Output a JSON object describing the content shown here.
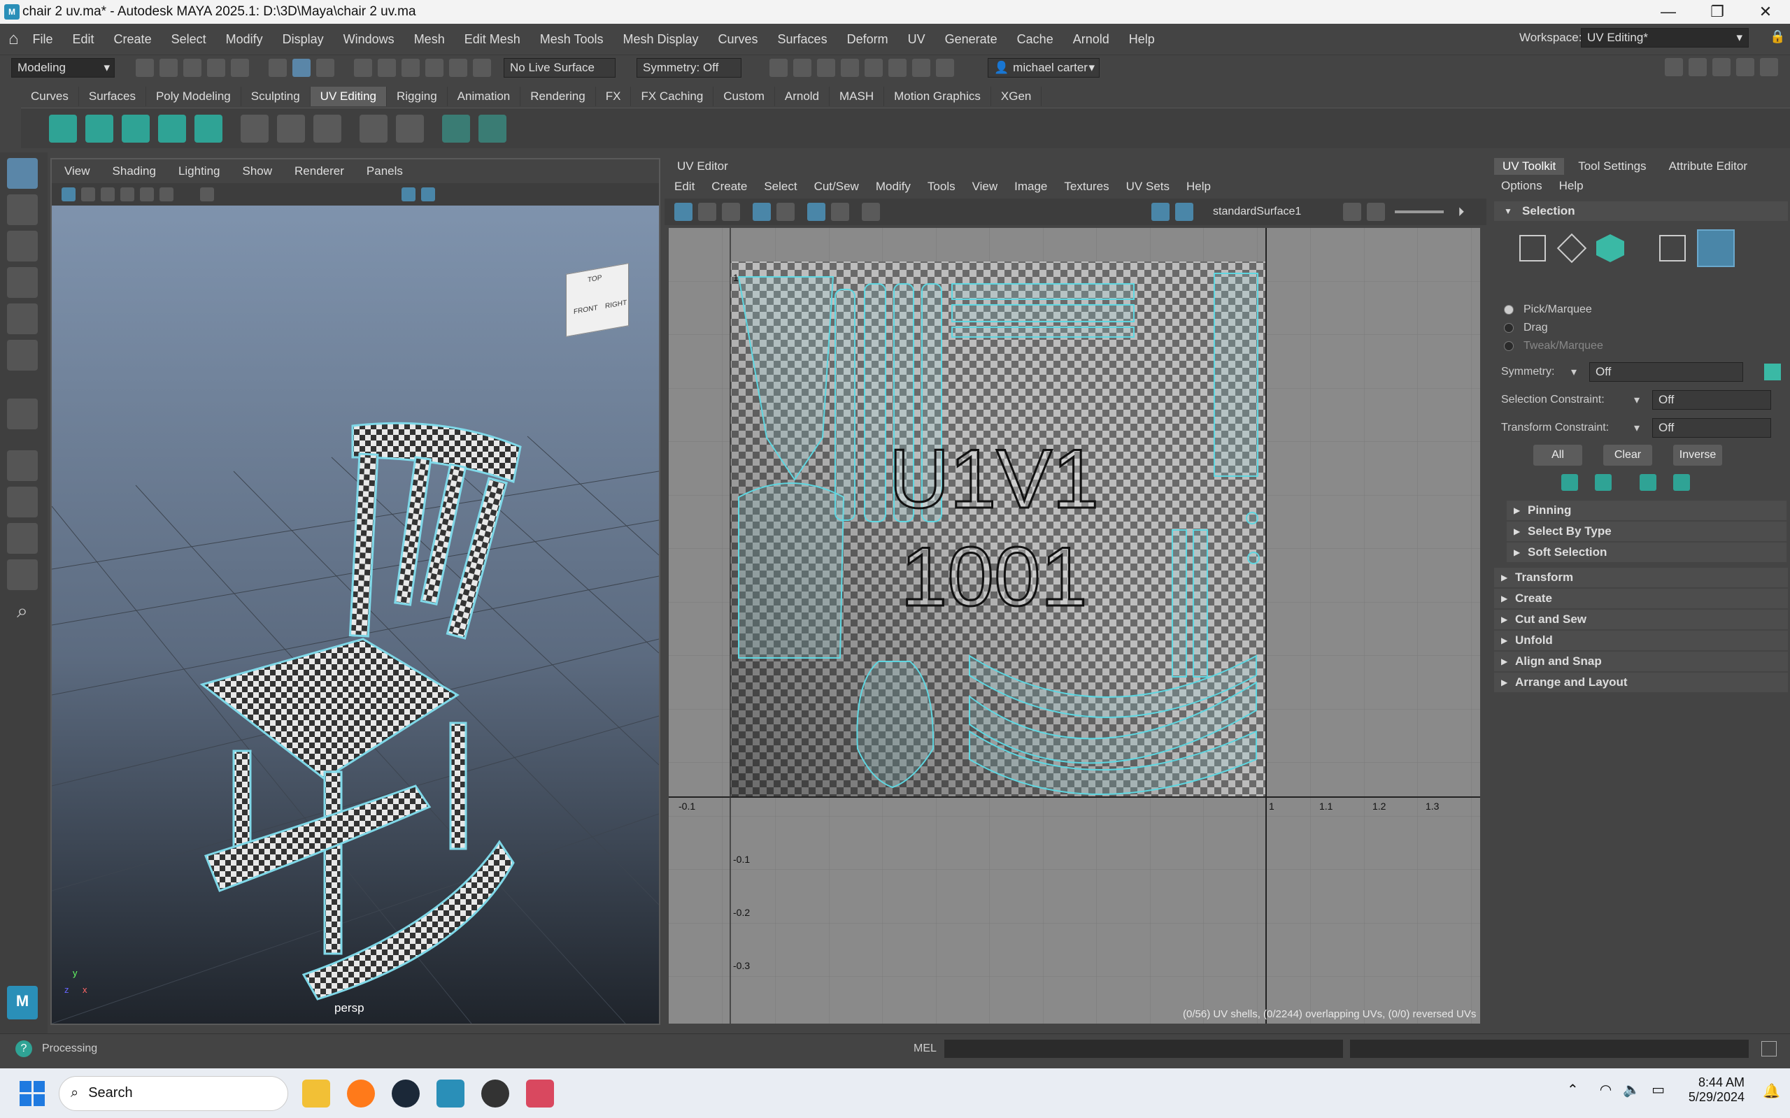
{
  "window": {
    "title": "chair 2 uv.ma* - Autodesk MAYA 2025.1: D:\\3D\\Maya\\chair 2 uv.ma"
  },
  "menubar": {
    "items": [
      "File",
      "Edit",
      "Create",
      "Select",
      "Modify",
      "Display",
      "Windows",
      "Mesh",
      "Edit Mesh",
      "Mesh Tools",
      "Mesh Display",
      "Curves",
      "Surfaces",
      "Deform",
      "UV",
      "Generate",
      "Cache",
      "Arnold",
      "Help"
    ],
    "workspace_label": "Workspace:",
    "workspace_value": "UV Editing*"
  },
  "statusline": {
    "mode": "Modeling",
    "live_surface": "No Live Surface",
    "symmetry": "Symmetry: Off",
    "user": "michael carter"
  },
  "shelf": {
    "tabs": [
      "Curves",
      "Surfaces",
      "Poly Modeling",
      "Sculpting",
      "UV Editing",
      "Rigging",
      "Animation",
      "Rendering",
      "FX",
      "FX Caching",
      "Custom",
      "Arnold",
      "MASH",
      "Motion Graphics",
      "XGen"
    ],
    "active": "UV Editing"
  },
  "viewport": {
    "menu": [
      "View",
      "Shading",
      "Lighting",
      "Show",
      "Renderer",
      "Panels"
    ],
    "camera_label": "persp",
    "cube_faces": {
      "top": "TOP",
      "front": "FRONT",
      "right": "RIGHT"
    },
    "axis_x": "x",
    "axis_y": "y",
    "axis_z": "z"
  },
  "uv_editor": {
    "title": "UV Editor",
    "menu": [
      "Edit",
      "Create",
      "Select",
      "Cut/Sew",
      "Modify",
      "Tools",
      "View",
      "Image",
      "Textures",
      "UV Sets",
      "Help"
    ],
    "texture_name": "standardSurface1",
    "tile_label_1": "U1V1",
    "tile_label_2": "1001",
    "axis_labels": {
      "x": [
        "-0.1",
        "1",
        "1.1",
        "1.2",
        "1.3"
      ],
      "y": [
        "1",
        "-0.1",
        "-0.2",
        "-0.3"
      ]
    },
    "stats": "(0/56) UV shells, (0/2244) overlapping UVs, (0/0) reversed UVs"
  },
  "toolkit": {
    "tabs": [
      "UV Toolkit",
      "Tool Settings",
      "Attribute Editor"
    ],
    "active_tab": "UV Toolkit",
    "menu": [
      "Options",
      "Help"
    ],
    "selection_title": "Selection",
    "modes": [
      "Pick/Marquee",
      "Drag",
      "Tweak/Marquee"
    ],
    "symmetry_label": "Symmetry:",
    "symmetry_value": "Off",
    "selection_constraint_label": "Selection Constraint:",
    "selection_constraint_value": "Off",
    "transform_constraint_label": "Transform Constraint:",
    "transform_constraint_value": "Off",
    "buttons": [
      "All",
      "Clear",
      "Inverse"
    ],
    "subsections": [
      "Pinning",
      "Select By Type",
      "Soft Selection"
    ],
    "sections": [
      "Transform",
      "Create",
      "Cut and Sew",
      "Unfold",
      "Align and Snap",
      "Arrange and Layout"
    ]
  },
  "bottom": {
    "status": "Processing",
    "mel_label": "MEL"
  },
  "taskbar": {
    "search": "Search",
    "time": "8:44 AM",
    "date": "5/29/2024"
  },
  "colors": {
    "accent": "#2fa395",
    "uv_cyan": "#5fd6e0",
    "bg": "#444444"
  }
}
